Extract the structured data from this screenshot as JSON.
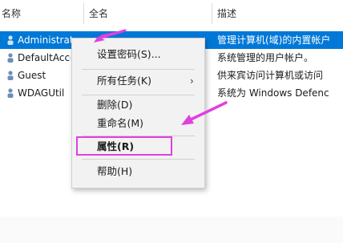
{
  "columns": {
    "name": "名称",
    "fullname": "全名",
    "description": "描述"
  },
  "users": [
    {
      "name": "Administrator",
      "description": "管理计算机(域)的内置帐户",
      "selected": true
    },
    {
      "name": "DefaultAcco",
      "description": "系统管理的用户帐户。",
      "selected": false
    },
    {
      "name": "Guest",
      "description": "供来宾访问计算机或访问",
      "selected": false
    },
    {
      "name": "WDAGUtil",
      "description": "系统为 Windows Defenc",
      "selected": false
    }
  ],
  "context_menu": {
    "items": [
      {
        "label": "设置密码(S)..."
      },
      {
        "label": "所有任务(K)",
        "submenu_arrow": "›"
      },
      {
        "label": "删除(D)"
      },
      {
        "label": "重命名(M)"
      },
      {
        "label": "属性(R)"
      },
      {
        "label": "帮助(H)"
      }
    ]
  },
  "annotation_color": "#e040e0",
  "selection_color": "#0078d7"
}
